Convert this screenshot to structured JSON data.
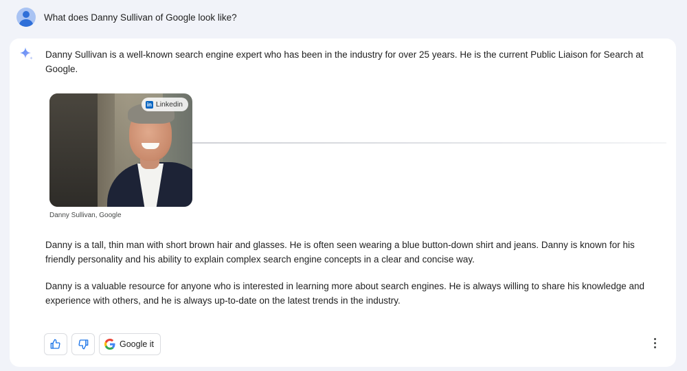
{
  "query": {
    "text": "What does Danny Sullivan of Google look like?"
  },
  "response": {
    "intro": "Danny Sullivan is a well-known search engine expert who has been in the industry for over 25 years. He is the current Public Liaison for Search at Google.",
    "image": {
      "source_label": "Linkedin",
      "caption": "Danny Sullivan, Google"
    },
    "paragraph_1": "Danny is a tall, thin man with short brown hair and glasses. He is often seen wearing a blue button-down shirt and jeans. Danny is known for his friendly personality and his ability to explain complex search engine concepts in a clear and concise way.",
    "paragraph_2": "Danny is a valuable resource for anyone who is interested in learning more about search engines. He is always willing to share his knowledge and experience with others, and he is always up-to-date on the latest trends in the industry."
  },
  "actions": {
    "google_it_label": "Google it"
  },
  "icons": {
    "thumbs_up": "thumbs-up-icon",
    "thumbs_down": "thumbs-down-icon",
    "google_logo": "google-logo-icon",
    "more": "more-vert-icon",
    "spark": "sparkle-icon",
    "avatar": "user-avatar-icon"
  },
  "colors": {
    "page_bg": "#f1f3f9",
    "card_bg": "#ffffff",
    "accent_blue": "#1a73e8",
    "linkedin_blue": "#0a66c2"
  }
}
